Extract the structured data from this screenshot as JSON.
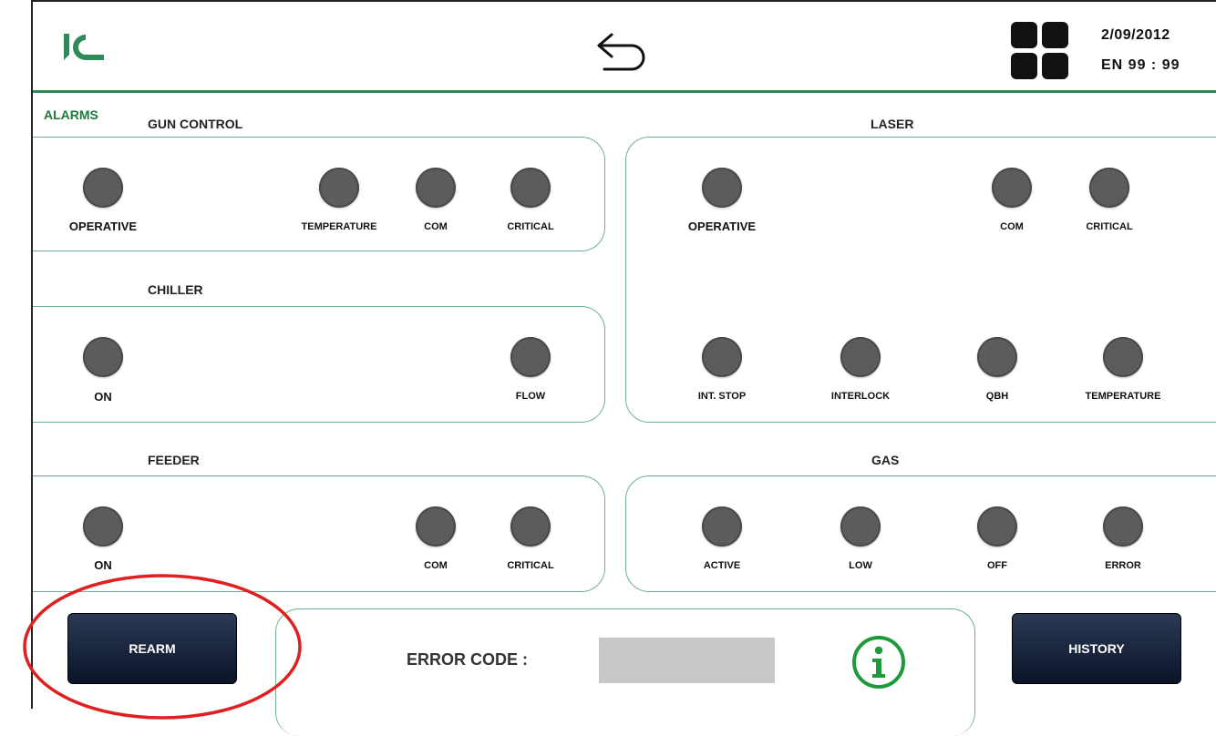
{
  "header": {
    "date": "2/09/2012",
    "time": "EN 99 : 99",
    "logo_icon": "company-logo",
    "back_icon": "back-arrow-icon",
    "grid_icon": "menu-grid-icon"
  },
  "page": {
    "title": "ALARMS"
  },
  "sections": {
    "gun_control": {
      "title": "GUN CONTROL",
      "indicators": [
        "OPERATIVE",
        "TEMPERATURE",
        "COM",
        "CRITICAL"
      ]
    },
    "laser": {
      "title": "LASER",
      "indicators_top": [
        "OPERATIVE",
        "COM",
        "CRITICAL"
      ],
      "indicators_bottom": [
        "INT. STOP",
        "INTERLOCK",
        "QBH",
        "TEMPERATURE"
      ]
    },
    "chiller": {
      "title": "CHILLER",
      "indicators": [
        "ON",
        "FLOW"
      ]
    },
    "feeder": {
      "title": "FEEDER",
      "indicators": [
        "ON",
        "COM",
        "CRITICAL"
      ]
    },
    "gas": {
      "title": "GAS",
      "indicators": [
        "ACTIVE",
        "LOW",
        "OFF",
        "ERROR"
      ]
    }
  },
  "footer": {
    "rearm_label": "REARM",
    "history_label": "HISTORY",
    "error_code_label": "ERROR CODE :",
    "error_code_value": "",
    "info_icon": "info-icon"
  },
  "colors": {
    "accent_green": "#2e8b57",
    "panel_border": "#6fae8a",
    "led_off": "#5c5c5c",
    "button_dark": "#0b1428",
    "annotation_red": "#e02020"
  }
}
